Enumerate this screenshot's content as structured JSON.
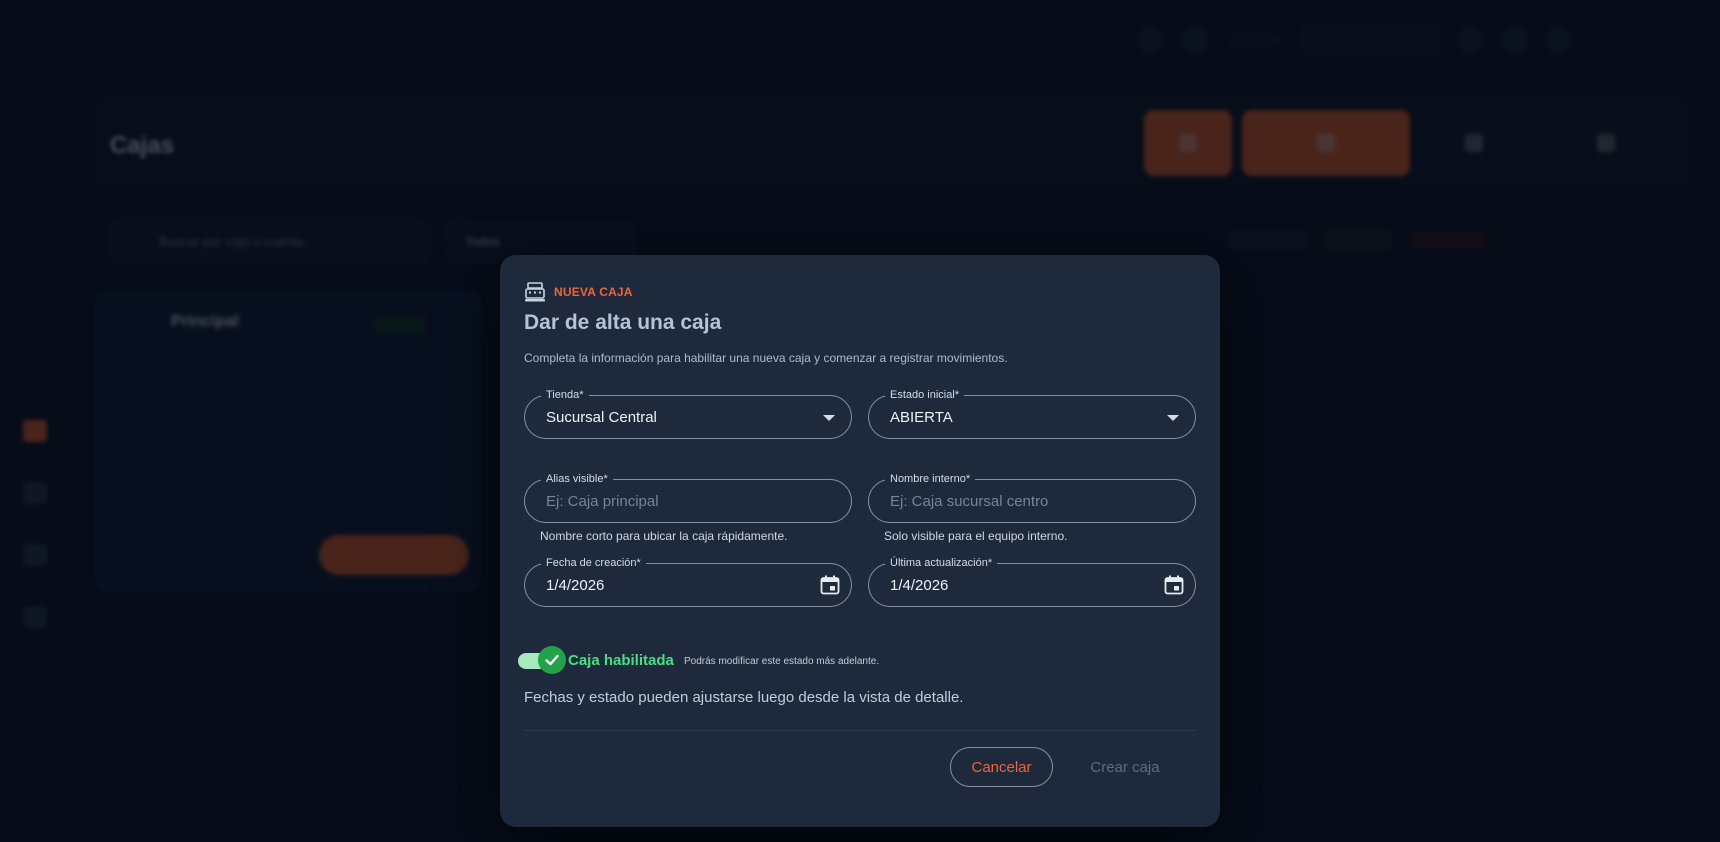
{
  "modal": {
    "kicker": "NUEVA CAJA",
    "title": "Dar de alta una caja",
    "description": "Completa la información para habilitar una nueva caja y comenzar a registrar movimientos.",
    "fields": {
      "tienda": {
        "label": "Tienda*",
        "value": "Sucursal Central"
      },
      "estado": {
        "label": "Estado inicial*",
        "value": "ABIERTA"
      },
      "alias": {
        "label": "Alias visible*",
        "placeholder": "Ej: Caja principal",
        "helper": "Nombre corto para ubicar la caja rápidamente."
      },
      "nombre": {
        "label": "Nombre interno*",
        "placeholder": "Ej: Caja sucursal centro",
        "helper": "Solo visible para el equipo interno."
      },
      "fecha_creacion": {
        "label": "Fecha de creación*",
        "value": "1/4/2026"
      },
      "ultima_actualizacion": {
        "label": "Última actualización*",
        "value": "1/4/2026"
      }
    },
    "toggle": {
      "label": "Caja habilitada",
      "hint": "Podrás modificar este estado más adelante.",
      "on": true
    },
    "note": "Fechas y estado pueden ajustarse luego desde la vista de detalle.",
    "cancel_label": "Cancelar",
    "create_label": "Crear caja"
  },
  "background": {
    "page_title": "Cajas",
    "search_placeholder": "Buscar por caja o cuenta...",
    "estado_filter_value": "Todos",
    "card_title": "Principal"
  },
  "colors": {
    "accent": "#f0643a",
    "success": "#4ade80",
    "modal_bg": "#1e2a3b"
  },
  "icons": {
    "kicker": "cash-register-icon",
    "calendar": "calendar-icon",
    "dropdown": "chevron-down-icon",
    "toggle": "check-icon"
  }
}
